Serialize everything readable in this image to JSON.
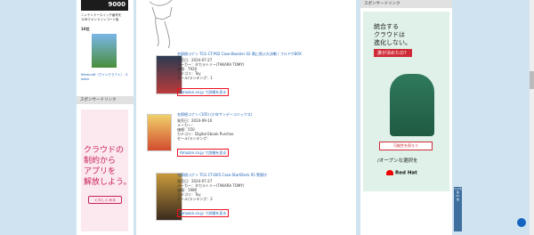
{
  "left": {
    "score": "9000",
    "notice": "ニンテンドースイッチ番号を\n1GBでオンラインコード版",
    "badge": "10位",
    "product_caption": "Minecraft（マインクラフト）- S\nwitch",
    "sponsor_header": "スポンサードリンク",
    "ad_text": "クラウドの\n制約から\nアプリを\n解放しよう。",
    "ad_button": "くわしくみる"
  },
  "main": {
    "products": [
      {
        "title": "名探偵コナン TCG CT-P02 Case-Booster 02 黒に飛ぶ大決戦 / ブルアクBOX",
        "lines": [
          "発売日：2024-07-27",
          "メーカー：タカラトミー(TAKARA TOMY)",
          "価格：7920",
          "カテゴリ：Toy",
          "セール/ランキング：1",
          "Amazon.co.jp で詳細を見る"
        ]
      },
      {
        "title": "名探偵コナン (105) (少年サンデーコミックス)",
        "lines": [
          "発売日：2024-09-10",
          "メーカー：",
          "価格：550",
          "カテゴリ：Digital Ebook Purchas",
          "セール/ランキング：",
          "Amazon.co.jp で詳細を見る"
        ]
      },
      {
        "title": "名探偵コナン TCG CT-D05 Case-StartDeck 05 警察庁",
        "lines": [
          "発売日：2024-07-27",
          "メーカー：タカラトミー(TAKARA TOMY)",
          "価格：1980",
          "カテゴリ：Toy",
          "セール/ランキング：2",
          "Amazon.co.jp で詳細を見る"
        ]
      }
    ]
  },
  "right": {
    "sponsor_header": "スポンサードリンク",
    "ad_line1": "統合する\nクラウドは\n進化しない。",
    "ad_pill": "誰が決めたの？",
    "ad_button": "可能性を探ろう",
    "ad_tagline": "/オープンな選択を",
    "ad_logo": "Red Hat"
  },
  "sidebar_button": "スマホ\n版\nPC\n版"
}
